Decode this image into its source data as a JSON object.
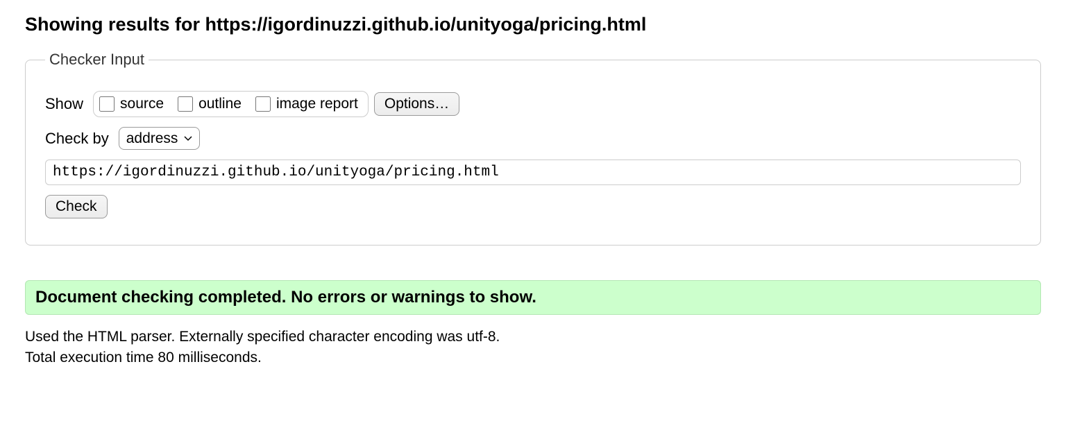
{
  "heading": "Showing results for https://igordinuzzi.github.io/unityoga/pricing.html",
  "fieldset": {
    "legend": "Checker Input",
    "show_label": "Show",
    "checkboxes": {
      "source": "source",
      "outline": "outline",
      "image_report": "image report"
    },
    "options_button": "Options…",
    "check_by_label": "Check by",
    "check_by_selected": "address",
    "url_value": "https://igordinuzzi.github.io/unityoga/pricing.html",
    "check_button": "Check"
  },
  "result": {
    "success_message": "Document checking completed. No errors or warnings to show.",
    "parser_info": "Used the HTML parser. Externally specified character encoding was utf-8.",
    "timing_info": "Total execution time 80 milliseconds."
  }
}
